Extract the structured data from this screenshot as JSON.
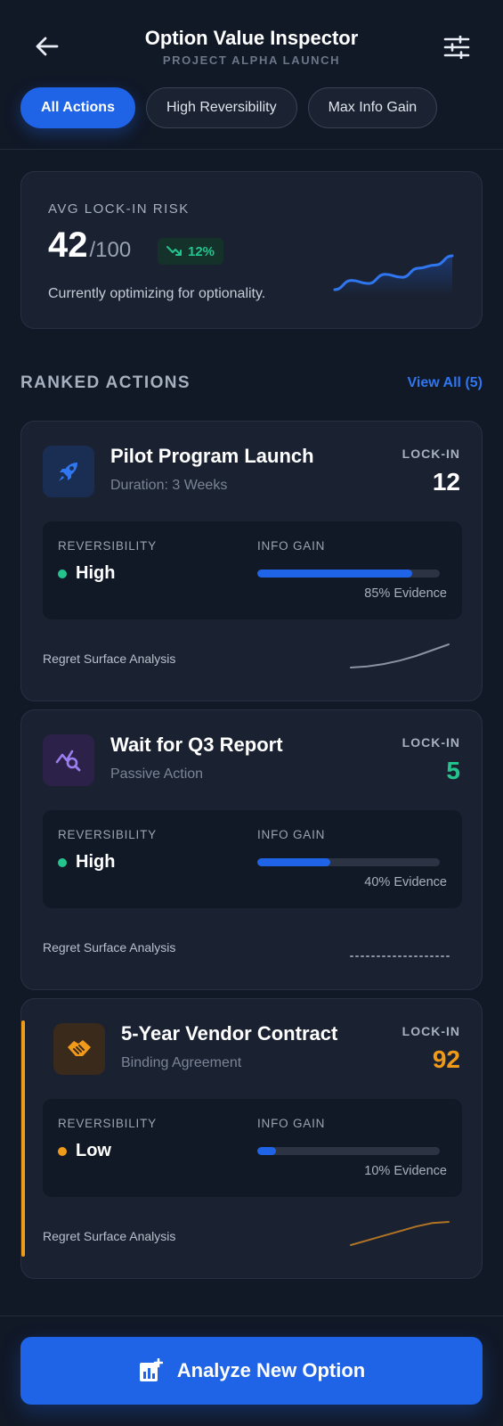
{
  "header": {
    "title": "Option Value Inspector",
    "subtitle": "PROJECT ALPHA LAUNCH",
    "back_icon": "arrow-left-icon",
    "settings_icon": "sliders-icon"
  },
  "filters": [
    {
      "label": "All Actions",
      "active": true
    },
    {
      "label": "High Reversibility",
      "active": false
    },
    {
      "label": "Max Info Gain",
      "active": false
    }
  ],
  "risk": {
    "label": "AVG LOCK-IN RISK",
    "value": "42",
    "denominator": "/100",
    "trend": "12%",
    "trend_icon": "trend-down-icon",
    "note": "Currently optimizing for optionality.",
    "sparkline": [
      2,
      5,
      4,
      7,
      6,
      9,
      10,
      13
    ]
  },
  "section": {
    "title": "RANKED ACTIONS",
    "view_all": "View All (5)"
  },
  "actions": [
    {
      "title": "Pilot Program Launch",
      "subtitle": "Duration: 3 Weeks",
      "icon": "rocket-icon",
      "lockin_label": "LOCK-IN",
      "lockin": "12",
      "lockin_color": "#ffffff",
      "reversibility_label": "REVERSIBILITY",
      "reversibility": "High",
      "reversibility_color": "#23c48e",
      "info_label": "INFO GAIN",
      "info_gain": 0.85,
      "evidence": "85% Evidence",
      "regret_label": "Regret Surface Analysis",
      "regret_curve": [
        0,
        0.5,
        1.5,
        3,
        5,
        7.5,
        10
      ],
      "regret_color": "#8a93a3",
      "regret_style": "solid"
    },
    {
      "title": "Wait for Q3 Report",
      "subtitle": "Passive Action",
      "icon": "chart-search-icon",
      "lockin_label": "LOCK-IN",
      "lockin": "5",
      "lockin_color": "#23c48e",
      "reversibility_label": "REVERSIBILITY",
      "reversibility": "High",
      "reversibility_color": "#23c48e",
      "info_label": "INFO GAIN",
      "info_gain": 0.4,
      "evidence": "40% Evidence",
      "regret_label": "Regret Surface Analysis",
      "regret_curve": [
        0,
        0,
        0,
        0,
        0,
        0,
        0
      ],
      "regret_color": "#8a93a3",
      "regret_style": "dotted"
    },
    {
      "title": "5-Year Vendor Contract",
      "subtitle": "Binding Agreement",
      "icon": "handshake-icon",
      "lockin_label": "LOCK-IN",
      "lockin": "92",
      "lockin_color": "#f09a1a",
      "reversibility_label": "REVERSIBILITY",
      "reversibility": "Low",
      "reversibility_color": "#f09a1a",
      "info_label": "INFO GAIN",
      "info_gain": 0.1,
      "evidence": "10% Evidence",
      "regret_label": "Regret Surface Analysis",
      "regret_curve": [
        0,
        2,
        4,
        6,
        8,
        9.5,
        10
      ],
      "regret_color": "#b07424",
      "regret_style": "solid"
    }
  ],
  "cta": {
    "label": "Analyze New Option",
    "icon": "chart-plus-icon"
  }
}
